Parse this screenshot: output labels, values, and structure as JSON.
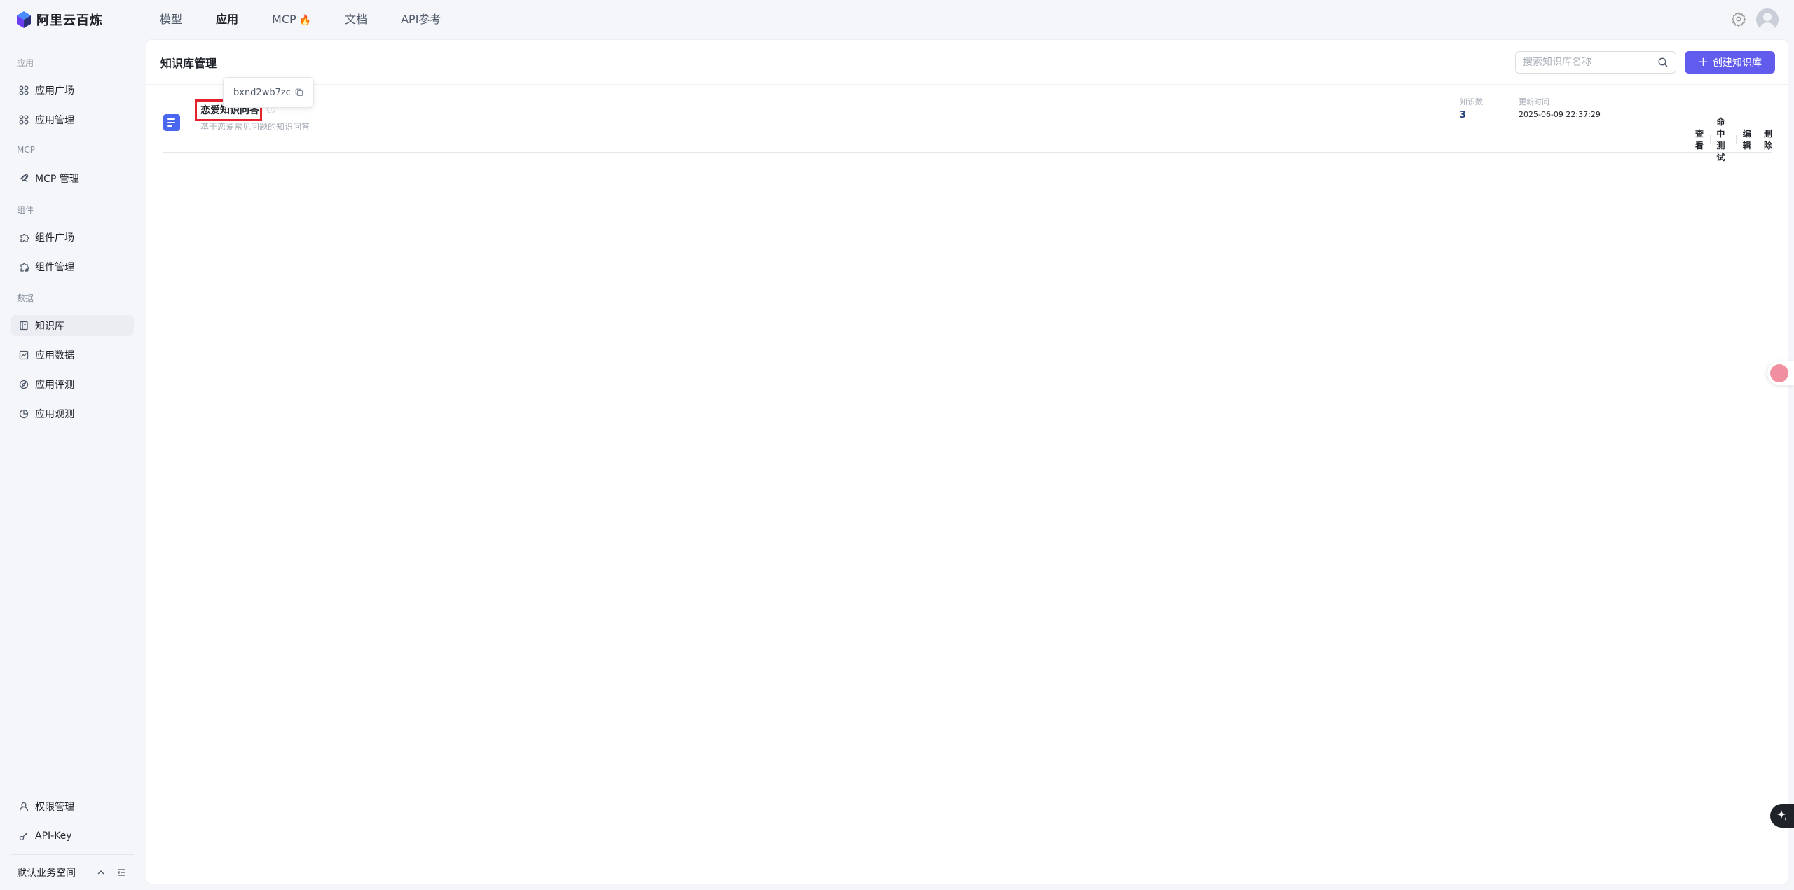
{
  "brand": {
    "name": "阿里云百炼"
  },
  "topnav": {
    "items": [
      {
        "label": "模型"
      },
      {
        "label": "应用"
      },
      {
        "label": "MCP"
      },
      {
        "label": "文档"
      },
      {
        "label": "API参考"
      }
    ],
    "active_index": 1
  },
  "sidebar": {
    "groups": [
      {
        "label": "应用"
      },
      {
        "label": "MCP"
      },
      {
        "label": "组件"
      },
      {
        "label": "数据"
      }
    ],
    "items": [
      {
        "label": "应用广场",
        "icon": "grid-icon"
      },
      {
        "label": "应用管理",
        "icon": "grid-icon"
      },
      {
        "label": "MCP 管理",
        "icon": "mcp-icon"
      },
      {
        "label": "组件广场",
        "icon": "puzzle-icon"
      },
      {
        "label": "组件管理",
        "icon": "puzzle-settings-icon"
      },
      {
        "label": "知识库",
        "icon": "book-icon"
      },
      {
        "label": "应用数据",
        "icon": "chart-icon"
      },
      {
        "label": "应用评测",
        "icon": "compass-icon"
      },
      {
        "label": "应用观测",
        "icon": "pie-icon"
      }
    ],
    "active_item": "知识库",
    "bottom_items": [
      {
        "label": "权限管理",
        "icon": "user-icon"
      },
      {
        "label": "API-Key",
        "icon": "key-icon"
      }
    ],
    "workspace": {
      "label": "默认业务空间"
    }
  },
  "main": {
    "title": "知识库管理",
    "search": {
      "placeholder": "搜索知识库名称",
      "value": ""
    },
    "create_button": {
      "label": "创建知识库"
    },
    "knowledge_bases": [
      {
        "name": "恋爱知识问答",
        "description": "基于恋爱常见问题的知识问答",
        "id": "bxnd2wb7zc",
        "count_label": "知识数",
        "count_value": "3",
        "updated_label": "更新时间",
        "updated_value": "2025-06-09 22:37:29",
        "actions": [
          "查看",
          "命中测试",
          "编辑",
          "删除"
        ]
      }
    ]
  },
  "colors": {
    "accent": "#615ced",
    "highlight_box": "#e3222c",
    "kb_icon": "#4a67f0"
  }
}
